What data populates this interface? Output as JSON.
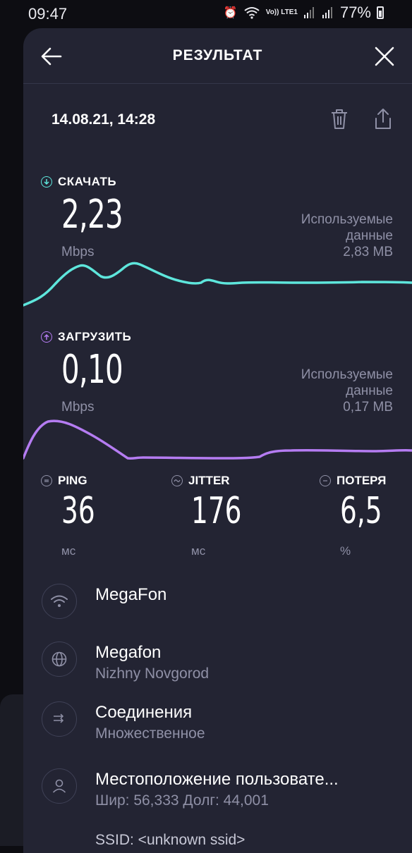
{
  "status_bar": {
    "time": "09:47",
    "network": "Vo)) LTE1",
    "battery": "77%"
  },
  "header": {
    "title": "РЕЗУЛЬТАТ"
  },
  "result": {
    "date": "14.08.21, 14:28"
  },
  "download": {
    "label": "СКАЧАТЬ",
    "value": "2,23",
    "unit": "Mbps",
    "used_label_1": "Используемые",
    "used_label_2": "данные",
    "used_value": "2,83 MB",
    "color": "#5ee6dc"
  },
  "upload": {
    "label": "ЗАГРУЗИТЬ",
    "value": "0,10",
    "unit": "Mbps",
    "used_label_1": "Используемые",
    "used_label_2": "данные",
    "used_value": "0,17 MB",
    "color": "#b57cf2"
  },
  "stats": {
    "ping": {
      "label": "PING",
      "value": "36",
      "unit": "мс"
    },
    "jitter": {
      "label": "JITTER",
      "value": "176",
      "unit": "мс"
    },
    "loss": {
      "label": "ПОТЕРЯ",
      "value": "6,5",
      "unit": "%"
    }
  },
  "info": {
    "provider": {
      "main": "MegaFon"
    },
    "server": {
      "main": "Megafon",
      "sub": "Nizhny Novgorod"
    },
    "connections": {
      "main": "Соединения",
      "sub": "Множественное"
    },
    "location": {
      "main": "Местоположение пользовате...",
      "sub": "Шир: 56,333 Долг: 44,001"
    },
    "ssid": {
      "main": "SSID: <unknown ssid>"
    }
  }
}
